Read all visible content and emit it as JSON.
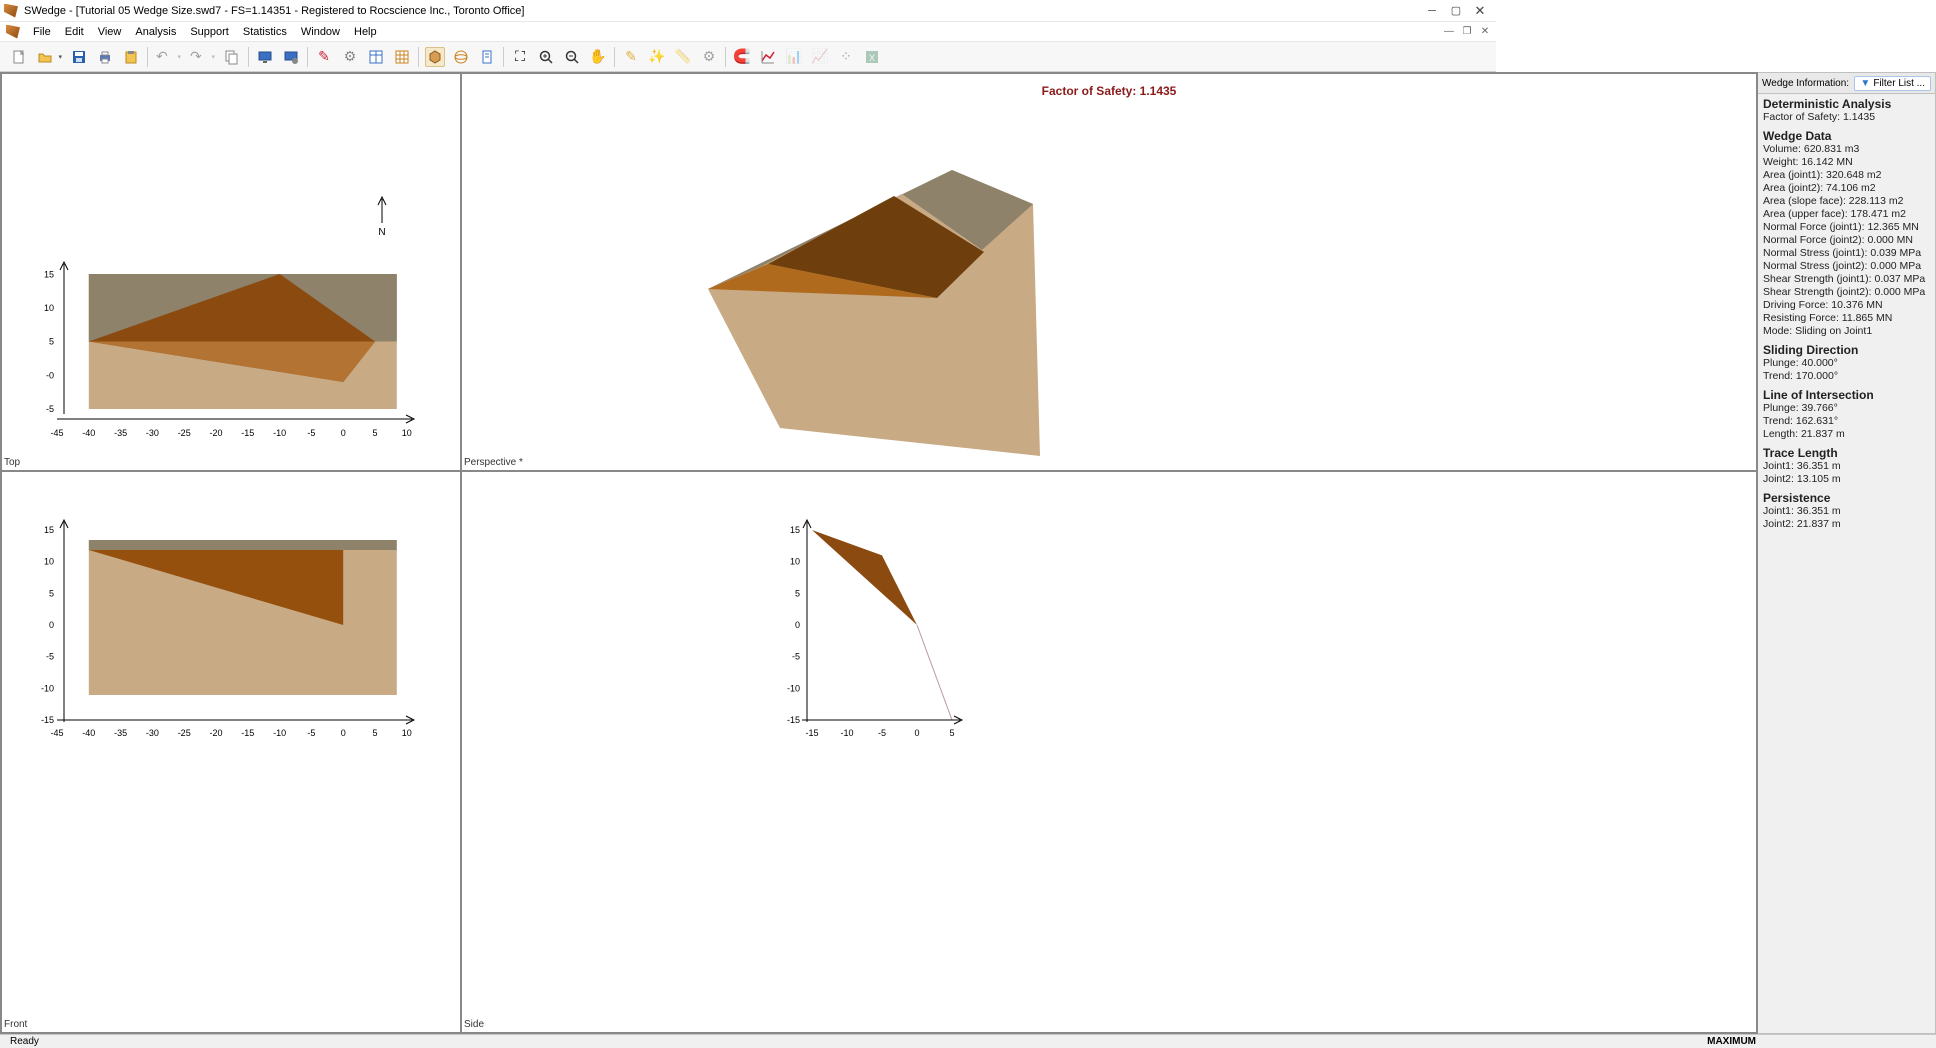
{
  "title": "SWedge - [Tutorial 05 Wedge Size.swd7 - FS=1.14351 - Registered to Rocscience Inc., Toronto Office]",
  "menu": [
    "File",
    "Edit",
    "View",
    "Analysis",
    "Support",
    "Statistics",
    "Window",
    "Help"
  ],
  "panes": {
    "tl": "Top",
    "tr": "Perspective *",
    "bl": "Front",
    "br": "Side"
  },
  "fos_banner": "Factor of Safety: 1.1435",
  "sidebar": {
    "header": "Wedge Information:",
    "filter": "Filter List ...",
    "det_hdr": "Deterministic Analysis",
    "det_fos": "Factor of Safety: 1.1435",
    "wedge_hdr": "Wedge Data",
    "wedge": [
      "Volume: 620.831 m3",
      "Weight: 16.142 MN",
      "Area (joint1): 320.648 m2",
      "Area (joint2): 74.106 m2",
      "Area (slope face): 228.113 m2",
      "Area (upper face): 178.471 m2",
      "Normal Force (joint1): 12.365 MN",
      "Normal Force (joint2): 0.000 MN",
      "Normal Stress (joint1): 0.039 MPa",
      "Normal Stress (joint2): 0.000 MPa",
      "Shear Strength (joint1): 0.037 MPa",
      "Shear Strength (joint2): 0.000 MPa",
      "Driving Force: 10.376 MN",
      "Resisting Force: 11.865 MN",
      "Mode: Sliding on Joint1"
    ],
    "sliding_hdr": "Sliding Direction",
    "sliding": [
      "Plunge: 40.000°",
      "Trend: 170.000°"
    ],
    "li_hdr": "Line of Intersection",
    "li": [
      "Plunge: 39.766°",
      "Trend: 162.631°",
      "Length: 21.837 m"
    ],
    "tl_hdr": "Trace Length",
    "tl": [
      "Joint1: 36.351 m",
      "Joint2: 13.105 m"
    ],
    "pers_hdr": "Persistence",
    "pers": [
      "Joint1: 36.351 m",
      "Joint2: 21.837 m"
    ]
  },
  "status": {
    "ready": "Ready",
    "max": "MAXIMUM"
  },
  "chart_data": [
    {
      "name": "Top",
      "type": "area",
      "xlim": [
        -45,
        10
      ],
      "ylim": [
        -5,
        15
      ],
      "xticks": [
        -45,
        -40,
        -35,
        -30,
        -25,
        -20,
        -15,
        -10,
        -5,
        0,
        5,
        10
      ],
      "yticks": [
        -5,
        0,
        5,
        10,
        15
      ],
      "series": [
        {
          "name": "slope-block",
          "fill": "#c8aa85",
          "pts": [
            [
              -40,
              -5
            ],
            [
              -40,
              15
            ],
            [
              10,
              15
            ],
            [
              10,
              -5
            ]
          ]
        },
        {
          "name": "upper-face",
          "fill": "#8f826b",
          "pts": [
            [
              -40,
              15
            ],
            [
              10,
              15
            ],
            [
              10,
              5
            ],
            [
              -40,
              5
            ]
          ]
        },
        {
          "name": "joint-wedge",
          "fill": "#8a4a10",
          "pts": [
            [
              -40,
              5
            ],
            [
              -10,
              15
            ],
            [
              5,
              5
            ],
            [
              0,
              -1
            ]
          ]
        },
        {
          "name": "shadow",
          "fill": "#b37433",
          "pts": [
            [
              -40,
              5
            ],
            [
              0,
              -1
            ],
            [
              5,
              5
            ]
          ]
        }
      ]
    },
    {
      "name": "Front",
      "type": "area",
      "xlim": [
        -45,
        10
      ],
      "ylim": [
        -15,
        15
      ],
      "xticks": [
        -45,
        -40,
        -35,
        -30,
        -25,
        -20,
        -15,
        -10,
        -5,
        0,
        5,
        10
      ],
      "yticks": [
        -15,
        -10,
        -5,
        0,
        5,
        10,
        15
      ],
      "series": [
        {
          "name": "slope-block",
          "fill": "#c8aa85",
          "pts": [
            [
              -40,
              -10
            ],
            [
              -40,
              13
            ],
            [
              10,
              13
            ],
            [
              10,
              -10
            ]
          ]
        },
        {
          "name": "upper-face",
          "fill": "#8f826b",
          "pts": [
            [
              -40,
              13
            ],
            [
              10,
              13
            ],
            [
              10,
              11.5
            ],
            [
              -40,
              11.5
            ]
          ]
        },
        {
          "name": "joint-wedge",
          "fill": "#96500e",
          "pts": [
            [
              -40,
              11.5
            ],
            [
              0,
              11.5
            ],
            [
              0,
              0
            ]
          ]
        }
      ]
    },
    {
      "name": "Side",
      "type": "area",
      "xlim": [
        -15,
        5
      ],
      "ylim": [
        -15,
        15
      ],
      "xticks": [
        -15,
        -10,
        -5,
        0,
        5
      ],
      "yticks": [
        -15,
        -10,
        -5,
        0,
        5,
        10,
        15
      ],
      "series": [
        {
          "name": "joint",
          "fill": "#8a4a10",
          "pts": [
            [
              -15,
              15
            ],
            [
              -5,
              11
            ],
            [
              0,
              0
            ]
          ]
        },
        {
          "name": "slope-line",
          "type": "line",
          "x": [
            0,
            5
          ],
          "y": [
            0,
            -15
          ]
        }
      ]
    },
    {
      "name": "Perspective",
      "type": "area",
      "series": [
        {
          "name": "slope-front",
          "fill": "#c8aa85"
        },
        {
          "name": "slope-top",
          "fill": "#8f826b"
        },
        {
          "name": "wedge-light",
          "fill": "#b06a1d"
        },
        {
          "name": "wedge-dark",
          "fill": "#6e3e0c"
        }
      ]
    }
  ]
}
